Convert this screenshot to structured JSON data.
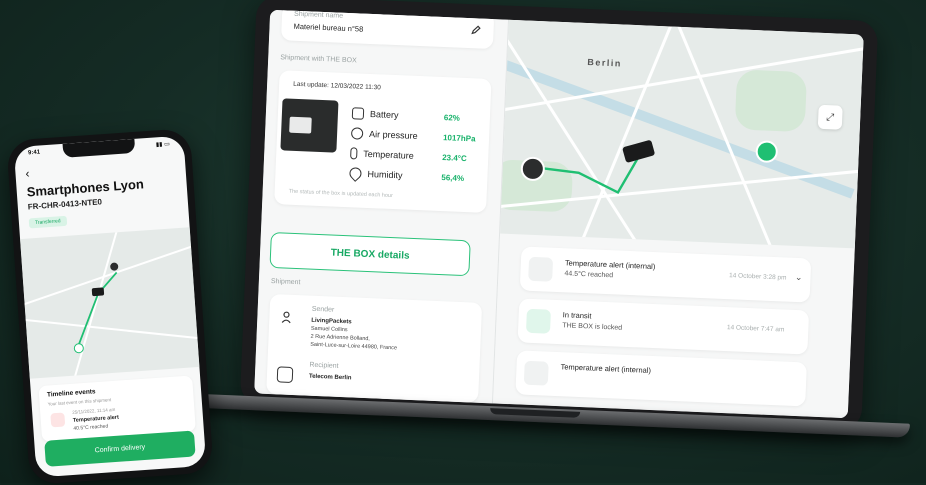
{
  "laptop": {
    "shipment_name_label": "Shipment name",
    "shipment_name_value": "Materiel bureau n°58",
    "shipment_with_label": "Shipment with THE BOX",
    "last_update": "Last update: 12/03/2022 11:30",
    "metrics": [
      {
        "name": "Battery",
        "value": "62%"
      },
      {
        "name": "Air pressure",
        "value": "1017hPa"
      },
      {
        "name": "Temperature",
        "value": "23.4°C"
      },
      {
        "name": "Humidity",
        "value": "56,4%"
      }
    ],
    "status_note": "The status of the box is updated each hour",
    "details_button": "THE BOX details",
    "shipment_label": "Shipment",
    "sender_label": "Sender",
    "sender_company": "LivingPackets",
    "sender_name": "Samuel Collins",
    "sender_address1": "2 Rue Adrienne Bolland,",
    "sender_address2": "Saint-Luce-sur-Loire 44980, France",
    "recipient_label": "Recipient",
    "recipient_company": "Telecom Berlin",
    "map_city": "Berlin",
    "events": [
      {
        "title": "Temperature alert (internal)",
        "sub": "44.5°C reached",
        "date": "14 October 3:28 pm"
      },
      {
        "title": "In transit",
        "sub": "THE BOX is locked",
        "date": "14 October 7:47 am"
      },
      {
        "title": "Temperature alert (internal)",
        "sub": "",
        "date": ""
      }
    ],
    "colors": {
      "accent": "#17b26a",
      "frame": "#1c1c1e"
    }
  },
  "phone": {
    "time": "9:41",
    "title": "Smartphones Lyon",
    "code": "FR-CHR-0413-NTE0",
    "badge": "Transferred",
    "timeline_title": "Timeline events",
    "timeline_sub": "Your last event on this shipment",
    "event_date": "25/11/2022, 11:14 am",
    "event_title": "Temperature alert",
    "event_sub": "40.5°C reached",
    "confirm_button": "Confirm delivery"
  }
}
